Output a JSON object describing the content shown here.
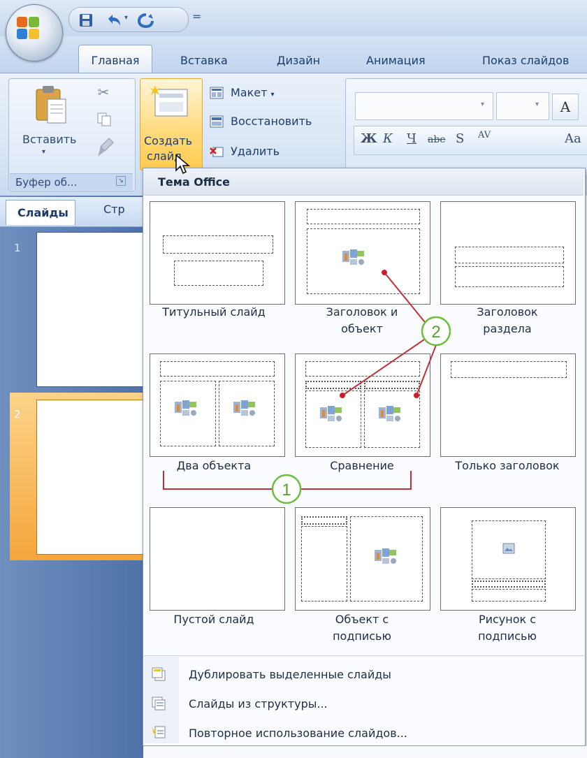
{
  "qat": {
    "save_icon": "save-icon",
    "undo_icon": "undo-icon",
    "redo_icon": "redo-icon",
    "more": "="
  },
  "tabs": [
    "Главная",
    "Вставка",
    "Дизайн",
    "Анимация",
    "Показ слайдов"
  ],
  "clipboard": {
    "paste_label": "Вставить",
    "group_label": "Буфер об...",
    "arrow": "▾"
  },
  "slides_group": {
    "new_slide_line1": "Создать",
    "new_slide_line2": "слайд",
    "layout_label": "Макет",
    "reset_label": "Восстановить",
    "delete_label": "Удалить"
  },
  "font": {
    "grow": "A",
    "buttons": [
      "Ж",
      "К",
      "Ч",
      "abe",
      "S",
      "AV",
      "Aa"
    ]
  },
  "panel": {
    "tab_slides": "Слайды",
    "tab_structure": "Стр",
    "slide1": "1",
    "slide2": "2"
  },
  "gallery": {
    "title": "Тема Office",
    "layouts": [
      {
        "line1": "Титульный слайд",
        "line2": ""
      },
      {
        "line1": "Заголовок и",
        "line2": "объект"
      },
      {
        "line1": "Заголовок",
        "line2": "раздела"
      },
      {
        "line1": "Два объекта",
        "line2": ""
      },
      {
        "line1": "Сравнение",
        "line2": ""
      },
      {
        "line1": "Только заголовок",
        "line2": ""
      },
      {
        "line1": "Пустой слайд",
        "line2": ""
      },
      {
        "line1": "Объект с",
        "line2": "подписью"
      },
      {
        "line1": "Рисунок с",
        "line2": "подписью"
      }
    ],
    "menu": [
      "Дублировать выделенные слайды",
      "Слайды из структуры...",
      "Повторное использование слайдов..."
    ]
  },
  "annotations": {
    "marker1": "1",
    "marker2": "2",
    "accent": "#c0303a",
    "marker_color": "#6cbf3c"
  }
}
